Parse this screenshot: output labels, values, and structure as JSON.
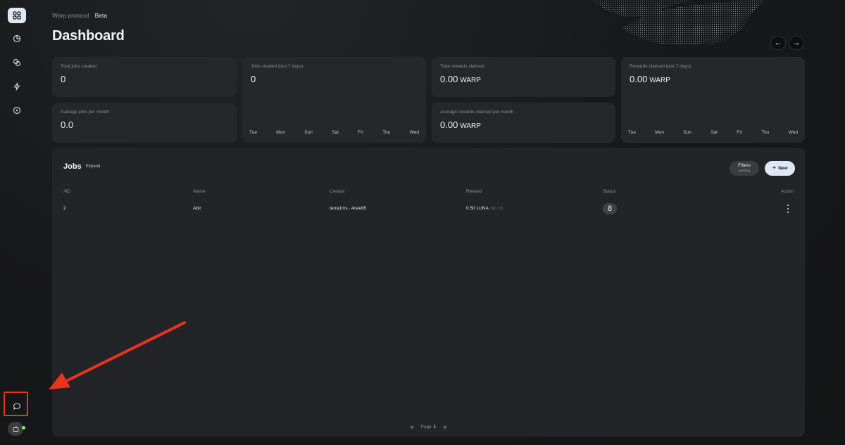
{
  "breadcrumb": {
    "parent": "Warp protocol",
    "current": "Beta"
  },
  "page_title": "Dashboard",
  "sidebar": {
    "items": [
      {
        "icon": "grid-icon",
        "active": true
      },
      {
        "icon": "pie-chart-icon",
        "active": false
      },
      {
        "icon": "coins-icon",
        "active": false
      },
      {
        "icon": "lightning-icon",
        "active": false
      },
      {
        "icon": "plus-circle-icon",
        "active": false
      }
    ],
    "bottom": [
      {
        "icon": "chat-icon"
      },
      {
        "icon": "wallet-icon",
        "status": "online"
      }
    ]
  },
  "stats": {
    "total_jobs_created": {
      "label": "Total jobs created",
      "value": "0"
    },
    "avg_jobs_per_month": {
      "label": "Average jobs per month",
      "value": "0.0"
    },
    "jobs_created_7d": {
      "label": "Jobs created (last 7 days)",
      "value": "0"
    },
    "total_rewards_claimed": {
      "label": "Total rewards claimed",
      "value": "0.00",
      "unit": "WARP"
    },
    "avg_rewards_per_month": {
      "label": "Average rewards claimed per month",
      "value": "0.00",
      "unit": "WARP"
    },
    "rewards_claimed_7d": {
      "label": "Rewards claimed (last 7 days)",
      "value": "0.00",
      "unit": "WARP"
    }
  },
  "days": [
    "Tue",
    "Mon",
    "Sun",
    "Sat",
    "Fri",
    "Thu",
    "Wed"
  ],
  "jobs": {
    "title": "Jobs",
    "expand": "Expand",
    "filters": {
      "label": "Filters",
      "sub": "pending"
    },
    "new_label": "New",
    "columns": [
      "#ID",
      "Name",
      "Creator",
      "Reward",
      "Status",
      "Action"
    ],
    "rows": [
      {
        "id": "2",
        "name": "Abir",
        "creator": "terra1ms...4cee65",
        "reward": "0.50 LUNA",
        "reward_usd": "($0.73)",
        "status": "8"
      }
    ],
    "pager": {
      "label": "Page",
      "page": "1"
    }
  },
  "colors": {
    "accent": "#dfe7f5",
    "highlight": "#e8331f",
    "online": "#7ef07a"
  }
}
